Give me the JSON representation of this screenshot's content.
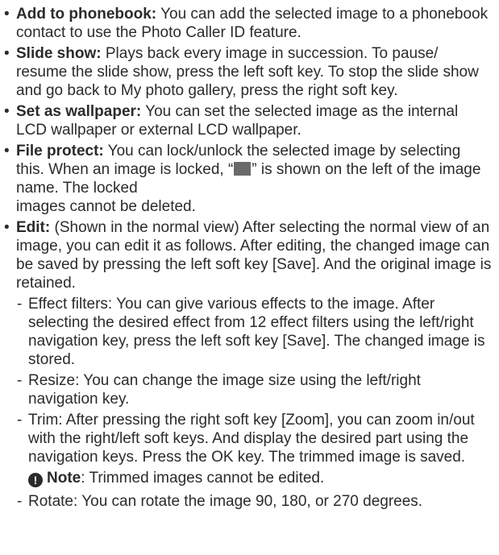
{
  "items": [
    {
      "title": "Add to phonebook:",
      "text": "You can add the selected image to a phonebook contact to use the Photo Caller ID feature."
    },
    {
      "title": "Slide show:",
      "text": "Plays back every image in succession. To pause/ resume the slide show, press the left soft key. To stop the slide show and go back to My photo gallery, press the right soft key."
    },
    {
      "title": "Set as wallpaper:",
      "text": "You can set the selected image as the internal LCD wallpaper or external LCD wallpaper."
    },
    {
      "title": "File protect:",
      "text_before": "You can lock/unlock the selected image by selecting this. When an image is locked, “",
      "text_after": "” is shown on the left of the image name. The locked",
      "text_line2": "images cannot be deleted."
    },
    {
      "title": "Edit:",
      "text": "(Shown in the normal view) After selecting the normal view of an image, you can edit it as follows. After editing, the changed image can be saved by pressing the left soft key [Save]. And the original image is retained."
    }
  ],
  "edit_options": [
    "Effect filters: You can give various effects to the image. After selecting the desired effect from 12 effect filters using the left/right navigation key, press the left soft key [Save]. The changed image is stored.",
    "Resize: You can change the image size using the left/right navigation key.",
    "Trim: After pressing the right soft key [Zoom], you can zoom in/out with the right/left soft keys. And display the desired part using the navigation keys. Press the OK key. The trimmed image is saved.",
    "Rotate: You can rotate the image 90, 180, or 270 degrees."
  ],
  "note": {
    "icon": "!",
    "label": "Note",
    "text": ": Trimmed images cannot be edited."
  },
  "glyphs": {
    "bullet": "•",
    "dash": "-"
  }
}
